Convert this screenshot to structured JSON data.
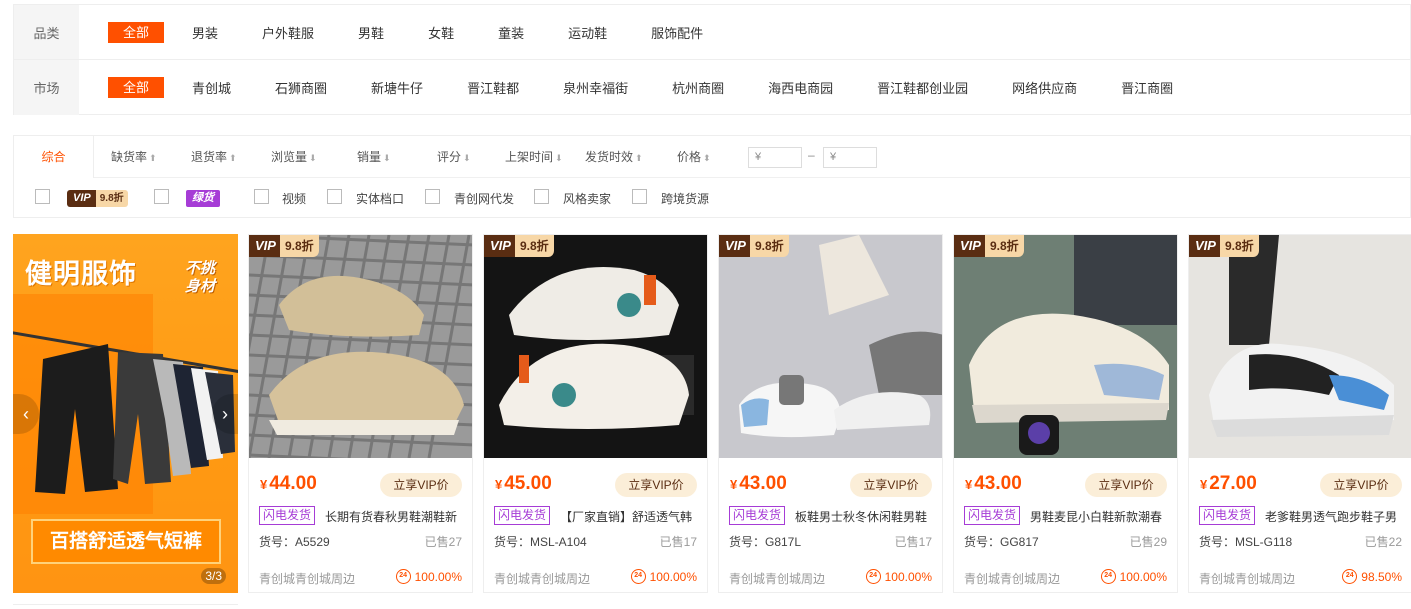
{
  "filters": {
    "category": {
      "label": "品类",
      "options": [
        "全部",
        "男装",
        "户外鞋服",
        "男鞋",
        "女鞋",
        "童装",
        "运动鞋",
        "服饰配件"
      ]
    },
    "market": {
      "label": "市场",
      "options": [
        "全部",
        "青创城",
        "石狮商圈",
        "新塘牛仔",
        "晋江鞋都",
        "泉州幸福街",
        "杭州商圈",
        "海西电商园",
        "晋江鞋都创业园",
        "网络供应商",
        "晋江商圈"
      ]
    }
  },
  "sort": {
    "items": [
      "综合",
      "缺货率",
      "退货率",
      "浏览量",
      "销量",
      "评分",
      "上架时间",
      "发货时效",
      "价格"
    ],
    "price_min_placeholder": "¥",
    "price_max_placeholder": "¥",
    "dash": "–"
  },
  "checks": {
    "vip_label": "VIP",
    "vip_discount": "9.8折",
    "green_label": "绿货",
    "options": [
      "视频",
      "实体档口",
      "青创网代发",
      "风格卖家",
      "跨境货源"
    ]
  },
  "banner": {
    "title": "健明服饰",
    "tag_line1": "不挑",
    "tag_line2": "身材",
    "bottom_text": "百搭舒适透气短裤",
    "counter": "3/3",
    "prev": "‹",
    "next": "›"
  },
  "products": [
    {
      "vip": "VIP",
      "discount": "9.8折",
      "price": "44.00",
      "vip_btn": "立享VIP价",
      "flash": "闪电发货",
      "title": "长期有货春秋男鞋潮鞋新",
      "sku": "货号：A5529",
      "sold": "已售27",
      "loc": "青创城青创城周边",
      "rate": "100.00%"
    },
    {
      "vip": "VIP",
      "discount": "9.8折",
      "price": "45.00",
      "vip_btn": "立享VIP价",
      "flash": "闪电发货",
      "title": "【厂家直销】舒适透气韩",
      "sku": "货号：MSL-A104",
      "sold": "已售17",
      "loc": "青创城青创城周边",
      "rate": "100.00%"
    },
    {
      "vip": "VIP",
      "discount": "9.8折",
      "price": "43.00",
      "vip_btn": "立享VIP价",
      "flash": "闪电发货",
      "title": "板鞋男士秋冬休闲鞋男鞋",
      "sku": "货号：G817L",
      "sold": "已售17",
      "loc": "青创城青创城周边",
      "rate": "100.00%"
    },
    {
      "vip": "VIP",
      "discount": "9.8折",
      "price": "43.00",
      "vip_btn": "立享VIP价",
      "flash": "闪电发货",
      "title": "男鞋麦昆小白鞋新款潮春",
      "sku": "货号：GG817",
      "sold": "已售29",
      "loc": "青创城青创城周边",
      "rate": "100.00%"
    },
    {
      "vip": "VIP",
      "discount": "9.8折",
      "price": "27.00",
      "vip_btn": "立享VIP价",
      "flash": "闪电发货",
      "title": "老爹鞋男透气跑步鞋子男",
      "sku": "货号：MSL-G118",
      "sold": "已售22",
      "loc": "青创城青创城周边",
      "rate": "98.50%"
    }
  ],
  "currency": "¥",
  "rate_icon": "24"
}
